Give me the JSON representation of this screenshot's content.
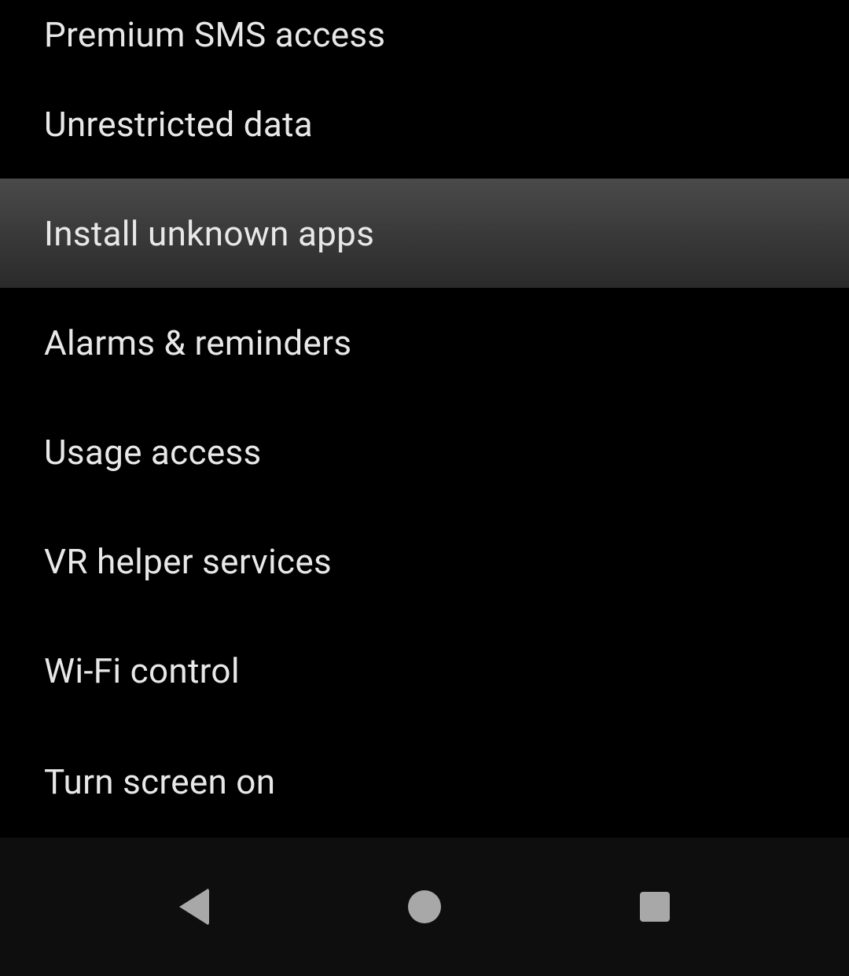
{
  "settings": {
    "items": [
      {
        "label": "Premium SMS access",
        "highlighted": false
      },
      {
        "label": "Unrestricted data",
        "highlighted": false
      },
      {
        "label": "Install unknown apps",
        "highlighted": true
      },
      {
        "label": "Alarms & reminders",
        "highlighted": false
      },
      {
        "label": "Usage access",
        "highlighted": false
      },
      {
        "label": "VR helper services",
        "highlighted": false
      },
      {
        "label": "Wi-Fi control",
        "highlighted": false
      },
      {
        "label": "Turn screen on",
        "highlighted": false
      }
    ]
  }
}
